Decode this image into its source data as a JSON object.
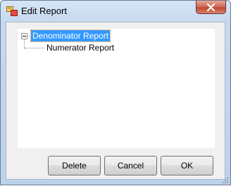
{
  "window": {
    "title": "Edit Report",
    "icon": "app-icon",
    "close_icon": "close-icon"
  },
  "tree": {
    "root": {
      "label": "Denominator Report",
      "expanded": true,
      "selected": true,
      "children": [
        {
          "label": "Numerator Report"
        }
      ]
    }
  },
  "buttons": {
    "delete_label": "Delete",
    "cancel_label": "Cancel",
    "ok_label": "OK"
  },
  "colors": {
    "selection": "#3399ff",
    "close_button": "#c04a30",
    "frame": "#c5d9ef"
  }
}
